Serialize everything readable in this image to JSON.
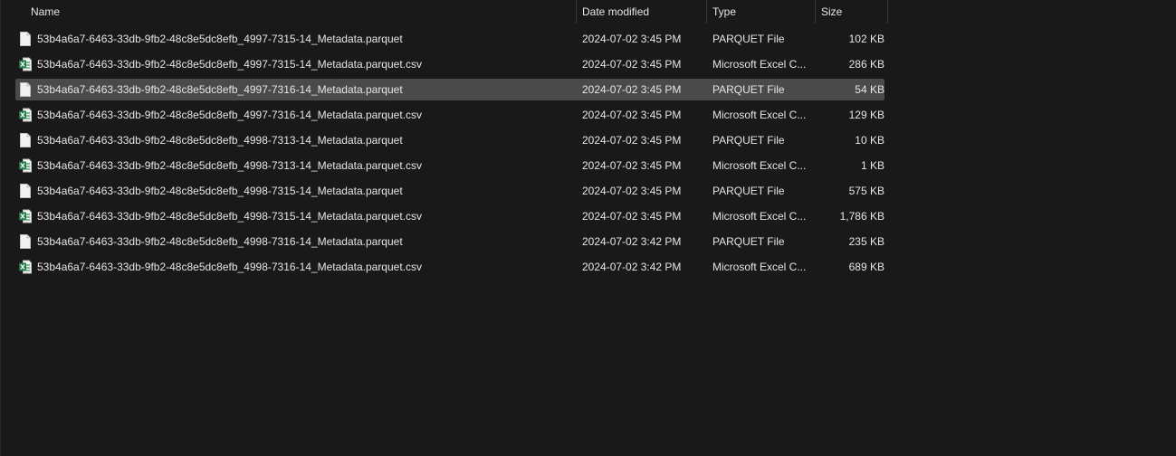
{
  "columns": {
    "name": "Name",
    "date": "Date modified",
    "type": "Type",
    "size": "Size",
    "sort_glyph": "^"
  },
  "files": [
    {
      "name": "53b4a6a7-6463-33db-9fb2-48c8e5dc8efb_4997-7315-14_Metadata.parquet",
      "date": "2024-07-02 3:45 PM",
      "type": "PARQUET File",
      "size": "102 KB",
      "icon": "file-icon"
    },
    {
      "name": "53b4a6a7-6463-33db-9fb2-48c8e5dc8efb_4997-7315-14_Metadata.parquet.csv",
      "date": "2024-07-02 3:45 PM",
      "type": "Microsoft Excel C...",
      "size": "286 KB",
      "icon": "excel-icon"
    },
    {
      "name": "53b4a6a7-6463-33db-9fb2-48c8e5dc8efb_4997-7316-14_Metadata.parquet",
      "date": "2024-07-02 3:45 PM",
      "type": "PARQUET File",
      "size": "54 KB",
      "icon": "file-icon",
      "selected": true
    },
    {
      "name": "53b4a6a7-6463-33db-9fb2-48c8e5dc8efb_4997-7316-14_Metadata.parquet.csv",
      "date": "2024-07-02 3:45 PM",
      "type": "Microsoft Excel C...",
      "size": "129 KB",
      "icon": "excel-icon"
    },
    {
      "name": "53b4a6a7-6463-33db-9fb2-48c8e5dc8efb_4998-7313-14_Metadata.parquet",
      "date": "2024-07-02 3:45 PM",
      "type": "PARQUET File",
      "size": "10 KB",
      "icon": "file-icon"
    },
    {
      "name": "53b4a6a7-6463-33db-9fb2-48c8e5dc8efb_4998-7313-14_Metadata.parquet.csv",
      "date": "2024-07-02 3:45 PM",
      "type": "Microsoft Excel C...",
      "size": "1 KB",
      "icon": "excel-icon"
    },
    {
      "name": "53b4a6a7-6463-33db-9fb2-48c8e5dc8efb_4998-7315-14_Metadata.parquet",
      "date": "2024-07-02 3:45 PM",
      "type": "PARQUET File",
      "size": "575 KB",
      "icon": "file-icon"
    },
    {
      "name": "53b4a6a7-6463-33db-9fb2-48c8e5dc8efb_4998-7315-14_Metadata.parquet.csv",
      "date": "2024-07-02 3:45 PM",
      "type": "Microsoft Excel C...",
      "size": "1,786 KB",
      "icon": "excel-icon"
    },
    {
      "name": "53b4a6a7-6463-33db-9fb2-48c8e5dc8efb_4998-7316-14_Metadata.parquet",
      "date": "2024-07-02 3:42 PM",
      "type": "PARQUET File",
      "size": "235 KB",
      "icon": "file-icon"
    },
    {
      "name": "53b4a6a7-6463-33db-9fb2-48c8e5dc8efb_4998-7316-14_Metadata.parquet.csv",
      "date": "2024-07-02 3:42 PM",
      "type": "Microsoft Excel C...",
      "size": "689 KB",
      "icon": "excel-icon"
    }
  ],
  "colors": {
    "background": "#191919",
    "selected_row": "#4a4a4a",
    "text": "#e6e6e6",
    "excel_green": "#1f7a45"
  }
}
